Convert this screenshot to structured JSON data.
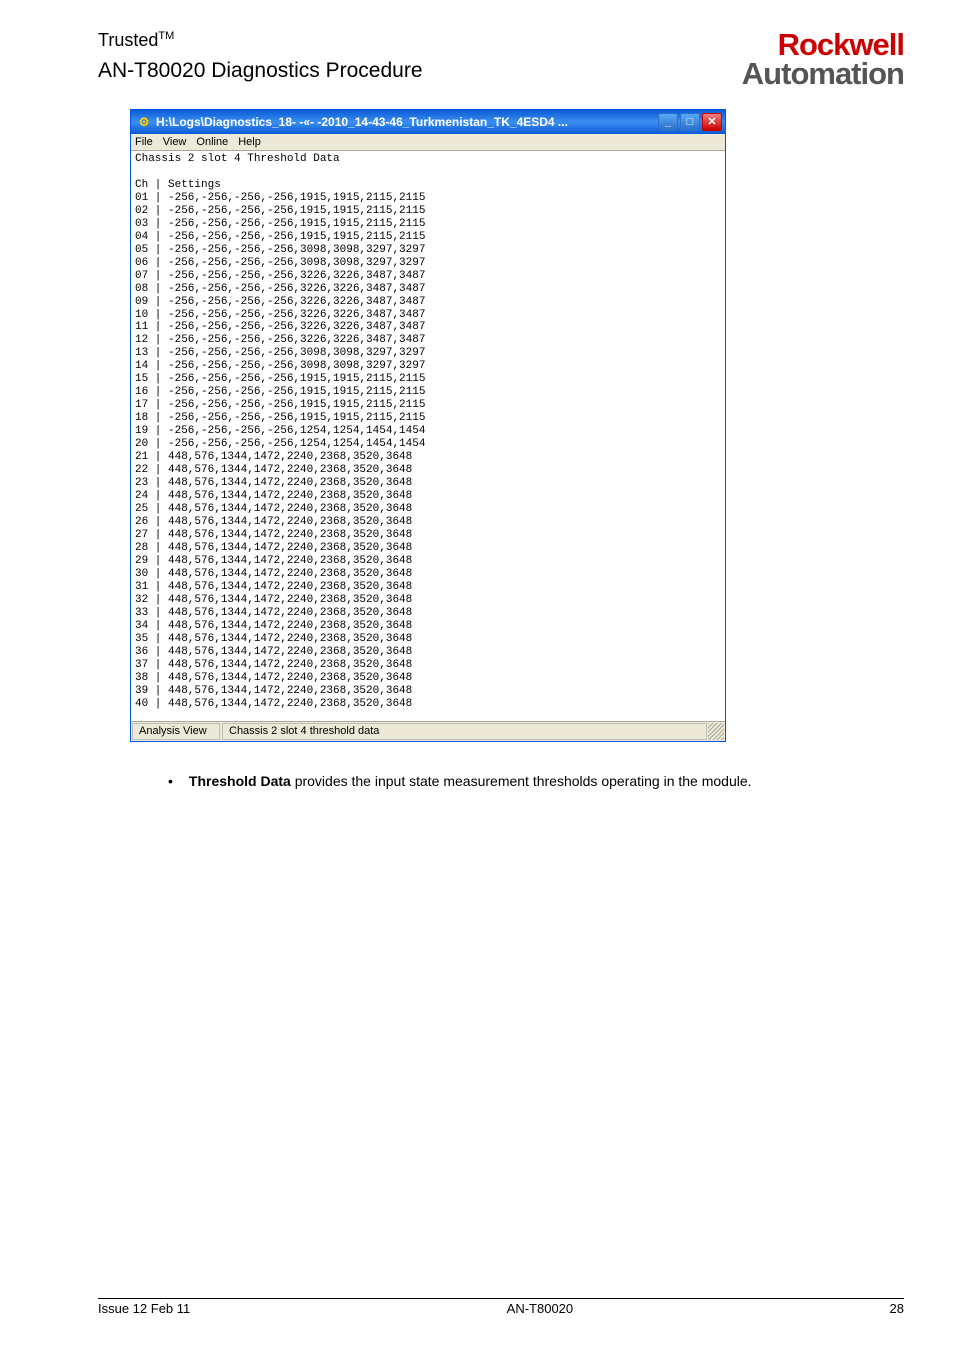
{
  "header": {
    "trusted": "Trusted",
    "tm": "TM",
    "doc_title": "AN-T80020 Diagnostics Procedure",
    "logo_top": "Rockwell",
    "logo_bottom": "Automation"
  },
  "window": {
    "title": "H:\\Logs\\Diagnostics_18- -«- -2010_14-43-46_Turkmenistan_TK_4ESD4 ...",
    "menu": {
      "file": "File",
      "view": "View",
      "online": "Online",
      "help": "Help"
    },
    "content_header": "Chassis 2 slot 4 Threshold Data",
    "ch_header": "Ch | Settings",
    "rows": [
      "01 | -256,-256,-256,-256,1915,1915,2115,2115",
      "02 | -256,-256,-256,-256,1915,1915,2115,2115",
      "03 | -256,-256,-256,-256,1915,1915,2115,2115",
      "04 | -256,-256,-256,-256,1915,1915,2115,2115",
      "05 | -256,-256,-256,-256,3098,3098,3297,3297",
      "06 | -256,-256,-256,-256,3098,3098,3297,3297",
      "07 | -256,-256,-256,-256,3226,3226,3487,3487",
      "08 | -256,-256,-256,-256,3226,3226,3487,3487",
      "09 | -256,-256,-256,-256,3226,3226,3487,3487",
      "10 | -256,-256,-256,-256,3226,3226,3487,3487",
      "11 | -256,-256,-256,-256,3226,3226,3487,3487",
      "12 | -256,-256,-256,-256,3226,3226,3487,3487",
      "13 | -256,-256,-256,-256,3098,3098,3297,3297",
      "14 | -256,-256,-256,-256,3098,3098,3297,3297",
      "15 | -256,-256,-256,-256,1915,1915,2115,2115",
      "16 | -256,-256,-256,-256,1915,1915,2115,2115",
      "17 | -256,-256,-256,-256,1915,1915,2115,2115",
      "18 | -256,-256,-256,-256,1915,1915,2115,2115",
      "19 | -256,-256,-256,-256,1254,1254,1454,1454",
      "20 | -256,-256,-256,-256,1254,1254,1454,1454",
      "21 | 448,576,1344,1472,2240,2368,3520,3648",
      "22 | 448,576,1344,1472,2240,2368,3520,3648",
      "23 | 448,576,1344,1472,2240,2368,3520,3648",
      "24 | 448,576,1344,1472,2240,2368,3520,3648",
      "25 | 448,576,1344,1472,2240,2368,3520,3648",
      "26 | 448,576,1344,1472,2240,2368,3520,3648",
      "27 | 448,576,1344,1472,2240,2368,3520,3648",
      "28 | 448,576,1344,1472,2240,2368,3520,3648",
      "29 | 448,576,1344,1472,2240,2368,3520,3648",
      "30 | 448,576,1344,1472,2240,2368,3520,3648",
      "31 | 448,576,1344,1472,2240,2368,3520,3648",
      "32 | 448,576,1344,1472,2240,2368,3520,3648",
      "33 | 448,576,1344,1472,2240,2368,3520,3648",
      "34 | 448,576,1344,1472,2240,2368,3520,3648",
      "35 | 448,576,1344,1472,2240,2368,3520,3648",
      "36 | 448,576,1344,1472,2240,2368,3520,3648",
      "37 | 448,576,1344,1472,2240,2368,3520,3648",
      "38 | 448,576,1344,1472,2240,2368,3520,3648",
      "39 | 448,576,1344,1472,2240,2368,3520,3648",
      "40 | 448,576,1344,1472,2240,2368,3520,3648"
    ],
    "status": {
      "mode": "Analysis View",
      "detail": "Chassis 2 slot 4 threshold data"
    }
  },
  "bullet": {
    "strong": "Threshold Data",
    "rest": " provides the input state measurement thresholds operating in the module."
  },
  "footer": {
    "left": "Issue 12 Feb 11",
    "center": "AN-T80020",
    "right": "28"
  }
}
